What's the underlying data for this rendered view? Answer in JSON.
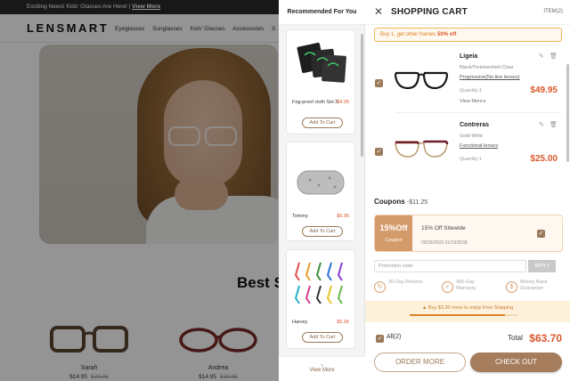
{
  "background": {
    "announcement": "Exciting News! Kids' Glasses Are Here! |",
    "announcement_link": "View More",
    "logo": "LENSMART",
    "nav": [
      "Eyeglasses",
      "Sunglasses",
      "Kids' Glasses",
      "Accessories",
      "S"
    ],
    "section_title": "Best S",
    "products": [
      {
        "name": "Sarah",
        "price": "$14.95",
        "old_price": "$29.95"
      },
      {
        "name": "Andrea",
        "price": "$14.95",
        "old_price": "$29.95"
      }
    ]
  },
  "recommended": {
    "title": "Recommended For You",
    "items": [
      {
        "name": "Fog-proof cloth Set 3",
        "price": "$4.95",
        "add_label": "Add To Cart"
      },
      {
        "name": "Tommy",
        "price": "$6.95",
        "add_label": "Add To Cart"
      },
      {
        "name": "Harvey",
        "price": "$5.95",
        "add_label": "Add To Cart"
      }
    ],
    "view_more": "View More"
  },
  "cart": {
    "title": "SHOPPING CART",
    "item_count": "ITEM(2)",
    "promo_prefix": "Buy 1, get other frames ",
    "promo_highlight": "50% off",
    "promo_suffix": ".",
    "items": [
      {
        "name": "Ligeia",
        "color": "Black/Tortoiseshell-Clear",
        "lens": "Progressive(No-line lenses)",
        "quantity": "Quantity:1",
        "price": "$49.95",
        "more": "View More∨"
      },
      {
        "name": "Contreras",
        "color": "Gold-Wine",
        "lens": "Functional-lenses",
        "quantity": "Quantity:1",
        "price": "$25.00"
      }
    ],
    "coupons_title": "Coupons",
    "coupons_amount": "-$11.25",
    "coupon": {
      "badge": "15%Off",
      "badge_sub": "Coupon",
      "title": "15% Off Sitewide",
      "dates": "09/26/2022-01/19/2038"
    },
    "promo_code_placeholder": "Promotion code",
    "apply_label": "APPLY",
    "perks": [
      "30-Day Returns",
      "365-Day Warranty",
      "Money Back Guarantee"
    ],
    "shipping_text": "Buy $3.30 more to enjoy Free Shipping",
    "shipping_progress": 0.88,
    "select_all": "All(2)",
    "total_label": "Total",
    "total_value": "$63.70",
    "order_more": "ORDER MORE",
    "checkout": "CHECK OUT"
  },
  "colors": {
    "accent": "#a57d5c",
    "price": "#d9572c",
    "promo": "#f0b45a"
  }
}
